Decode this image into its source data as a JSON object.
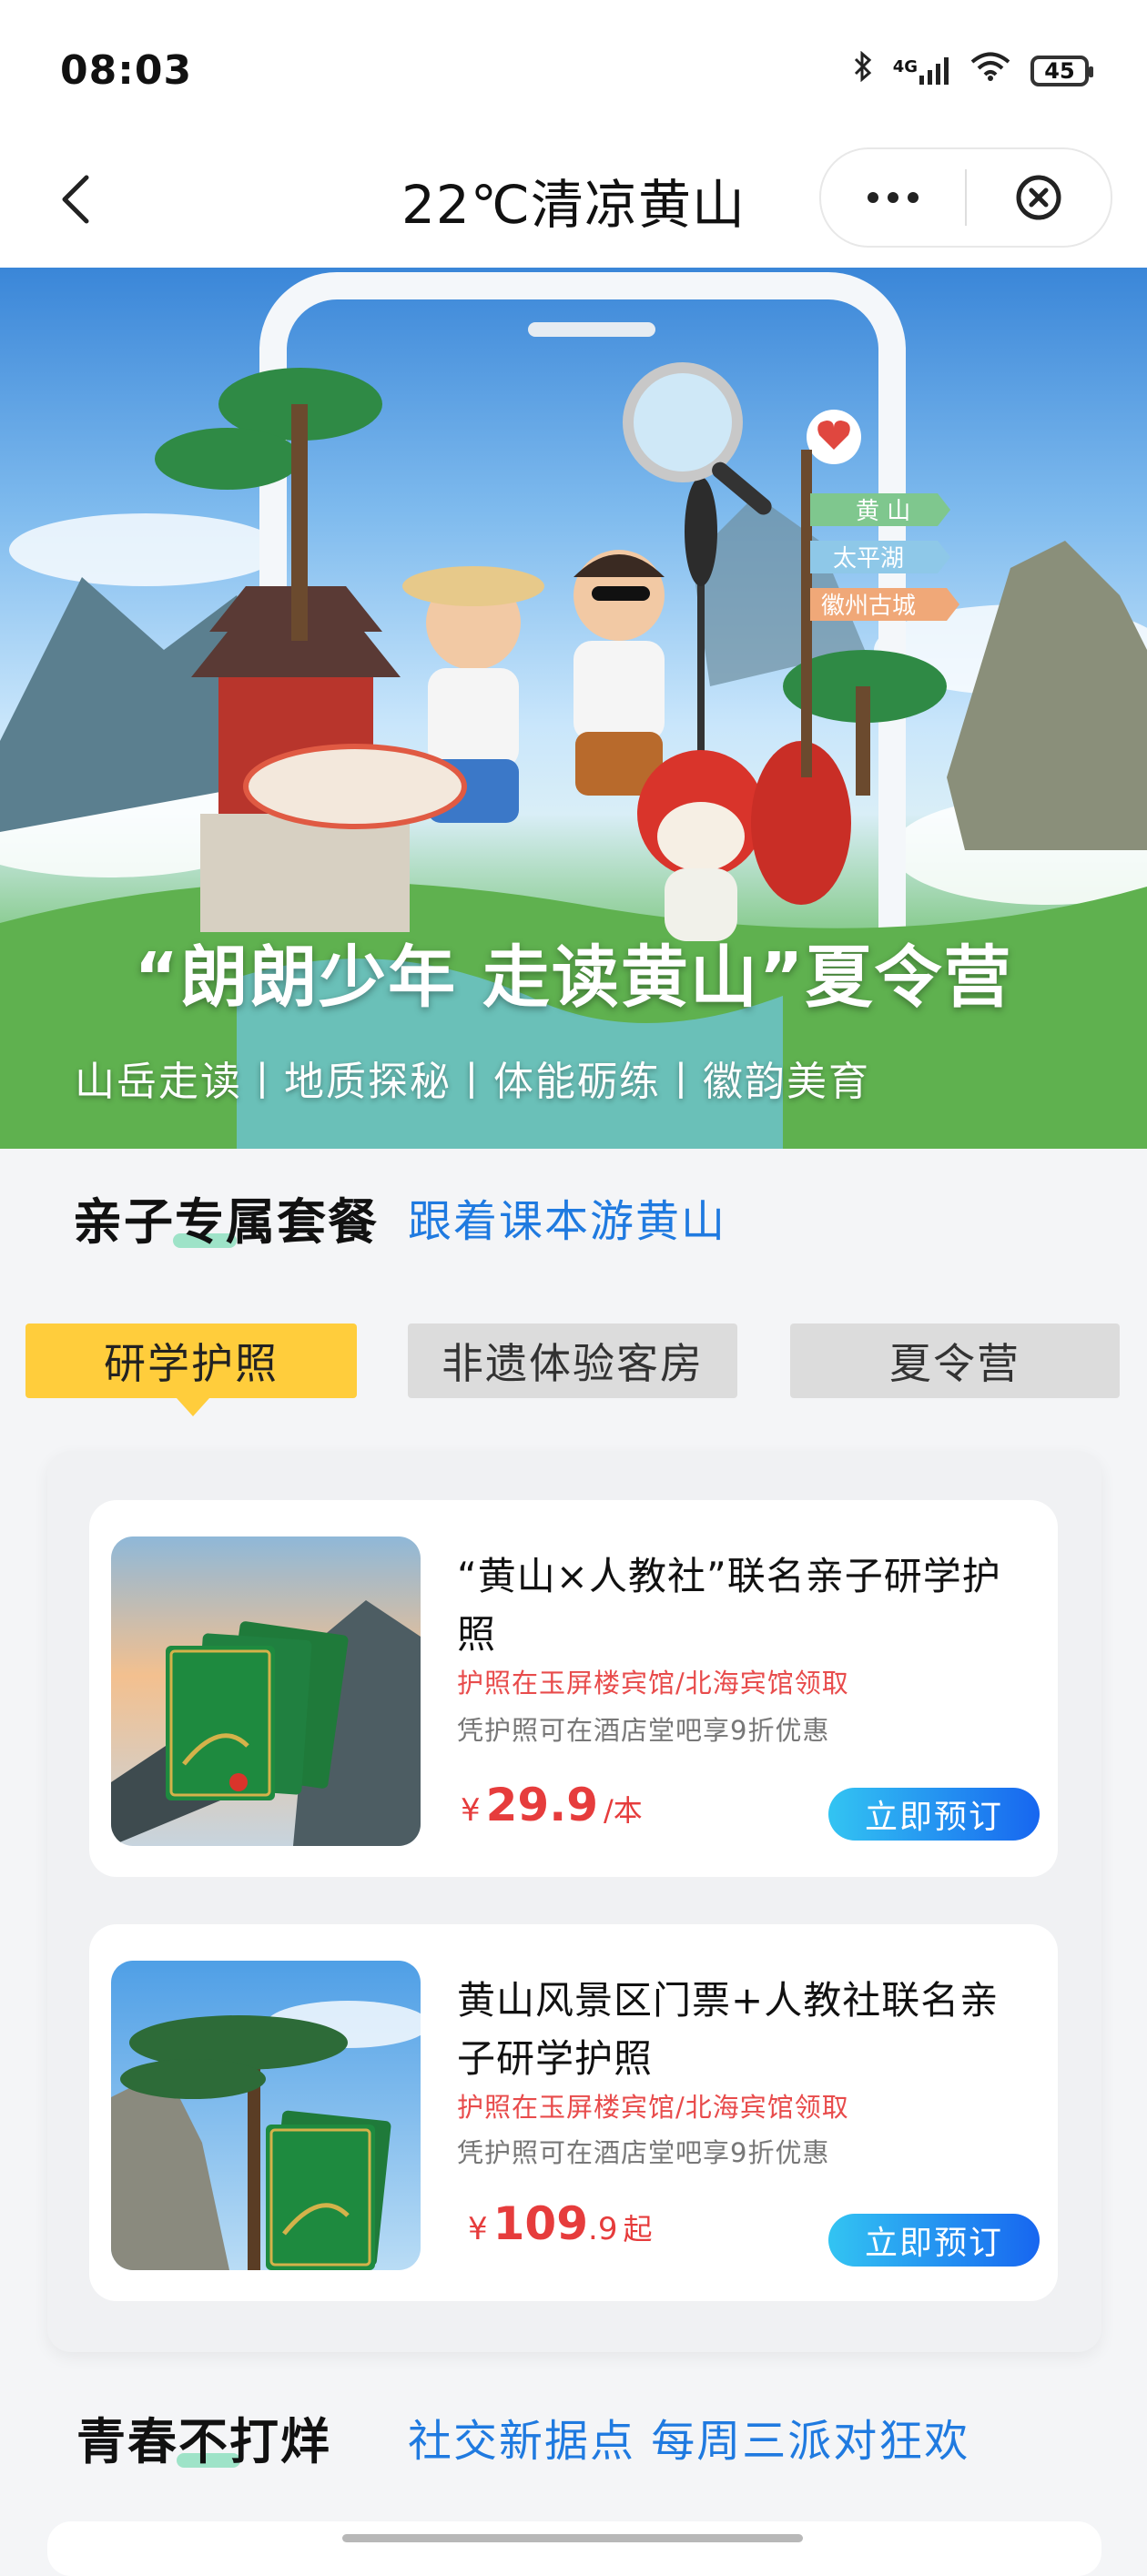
{
  "status_bar": {
    "time": "08:03",
    "network": "4G",
    "battery": "45"
  },
  "nav": {
    "title": "22℃清凉黄山"
  },
  "banner": {
    "title": "“朗朗少年 走读黄山”夏令营",
    "subtitle": "山岳走读丨地质探秘丨体能砺练丨徽韵美育",
    "signpost": [
      "黄 山",
      "太平湖",
      "徽州古城"
    ]
  },
  "family_section": {
    "title": "亲子专属套餐",
    "subtitle": "跟着课本游黄山",
    "tabs": [
      {
        "label": "研学护照",
        "active": true
      },
      {
        "label": "非遗体验客房",
        "active": false
      },
      {
        "label": "夏令营",
        "active": false
      }
    ],
    "products": [
      {
        "name": "“黄山×人教社”联名亲子研学护照",
        "pickup": "护照在玉屏楼宾馆/北海宾馆领取",
        "perk": "凭护照可在酒店堂吧享9折优惠",
        "price_symbol": "¥",
        "price": "29.9",
        "price_unit": "/本",
        "button": "立即预订"
      },
      {
        "name": "黄山风景区门票+人教社联名亲子研学护照",
        "pickup": "护照在玉屏楼宾馆/北海宾馆领取",
        "perk": "凭护照可在酒店堂吧享9折优惠",
        "price_symbol": "¥",
        "price_int": "109",
        "price_dec": ".9",
        "price_unit": "起",
        "button": "立即预订"
      }
    ]
  },
  "youth_section": {
    "title": "青春不打烊",
    "subtitle": "社交新据点 每周三派对狂欢"
  },
  "colors": {
    "accent_blue": "#1f7ae0",
    "tab_active": "#ffcd3c",
    "price_red": "#e63c3c"
  }
}
